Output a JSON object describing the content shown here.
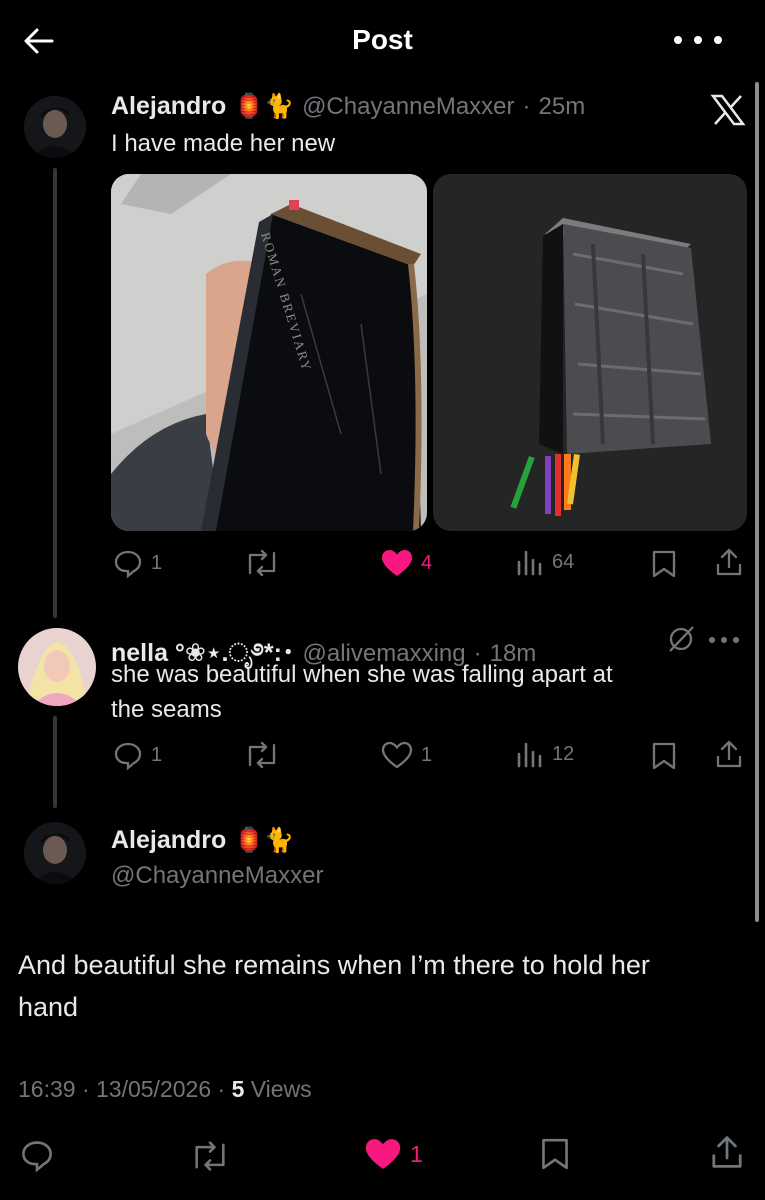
{
  "header": {
    "title": "Post"
  },
  "tweet1": {
    "name": "Alejandro",
    "emojis": "🏮🐈",
    "handle": "@ChayanneMaxxer",
    "sep": "·",
    "time": "25m",
    "text": "I have made her new",
    "book_spine_text": "ROMAN BREVIARY",
    "replies": "1",
    "likes": "4",
    "views": "64"
  },
  "tweet2": {
    "name": "nella °❀⋆.ೃ࿔*:･",
    "handle": "@alivemaxxing",
    "sep": "·",
    "time": "18m",
    "text_line1": "she was beautiful when she was falling apart at",
    "text_line2": "the seams",
    "replies": "1",
    "likes": "1",
    "views": "12"
  },
  "main": {
    "name": "Alejandro",
    "emojis": "🏮🐈",
    "handle": "@ChayanneMaxxer",
    "text_line1": "And beautiful she remains when I’m there to hold her",
    "text_line2": "hand",
    "timestamp": "16:39 · 13/05/2026 · ",
    "views_count": "5",
    "views_label": " Views",
    "likes": "1"
  },
  "colors": {
    "accent_pink": "#f91880",
    "muted": "#71767b",
    "text": "#e7e9ea"
  }
}
